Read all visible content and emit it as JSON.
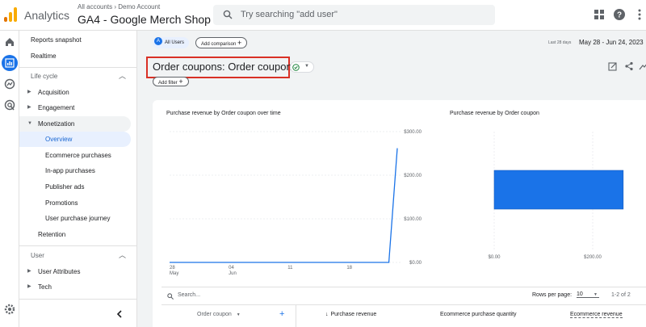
{
  "topbar": {
    "app_name": "Analytics",
    "breadcrumb": "All accounts › Demo Account",
    "property": "GA4 - Google Merch Shop",
    "search_placeholder": "Try searching \"add user\""
  },
  "sidebar": {
    "reports_snapshot": "Reports snapshot",
    "realtime": "Realtime",
    "lifecycle_label": "Life cycle",
    "acquisition": "Acquisition",
    "engagement": "Engagement",
    "monetization": "Monetization",
    "overview": "Overview",
    "ecommerce_purchases": "Ecommerce purchases",
    "in_app_purchases": "In-app purchases",
    "publisher_ads": "Publisher ads",
    "promotions": "Promotions",
    "user_purchase_journey": "User purchase journey",
    "retention": "Retention",
    "user_label": "User",
    "user_attributes": "User Attributes",
    "tech": "Tech"
  },
  "header": {
    "all_users": "All Users",
    "all_users_avatar": "A",
    "add_comparison": "Add comparison",
    "date_label": "Last 28 days",
    "date_range": "May 28 - Jun 24, 2023",
    "title": "Order coupons: Order coupon",
    "add_filter": "Add filter"
  },
  "colors": {
    "brand_blue": "#1a73e8",
    "bar_blue": "#1a73e8",
    "title_border": "#d93025",
    "check_green": "#188038"
  },
  "charts": {
    "line_title": "Purchase revenue by Order coupon over time",
    "bar_title": "Purchase revenue by Order coupon"
  },
  "chart_data": [
    {
      "type": "line",
      "title": "Purchase revenue by Order coupon over time",
      "x_ticks": [
        {
          "day": "28",
          "month": "May"
        },
        {
          "day": "04",
          "month": "Jun"
        },
        {
          "day": "11",
          "month": ""
        },
        {
          "day": "18",
          "month": ""
        }
      ],
      "y_ticks": [
        "$300.00",
        "$200.00",
        "$100.00",
        "$0.00"
      ],
      "ylim": [
        0,
        300
      ],
      "x": [
        "May 28",
        "May 29",
        "May 30",
        "May 31",
        "Jun 1",
        "Jun 2",
        "Jun 3",
        "Jun 4",
        "Jun 5",
        "Jun 6",
        "Jun 7",
        "Jun 8",
        "Jun 9",
        "Jun 10",
        "Jun 11",
        "Jun 12",
        "Jun 13",
        "Jun 14",
        "Jun 15",
        "Jun 16",
        "Jun 17",
        "Jun 18",
        "Jun 19",
        "Jun 20",
        "Jun 21",
        "Jun 22",
        "Jun 23",
        "Jun 24"
      ],
      "series": [
        {
          "values": [
            0,
            0,
            0,
            0,
            0,
            0,
            0,
            0,
            0,
            0,
            0,
            0,
            0,
            0,
            0,
            0,
            0,
            0,
            0,
            0,
            0,
            0,
            0,
            0,
            0,
            0,
            0,
            262
          ]
        }
      ]
    },
    {
      "type": "bar",
      "orientation": "horizontal",
      "title": "Purchase revenue by Order coupon",
      "x_ticks": [
        "$0.00",
        "$200.00"
      ],
      "xlim": [
        0,
        200
      ],
      "values": [
        262
      ]
    }
  ],
  "table": {
    "search_placeholder": "Search...",
    "rows_per_page_label": "Rows per page:",
    "rows_per_page": "10",
    "pagination": "1-2 of 2",
    "col_dimension": "Order coupon",
    "col_revenue": "Purchase revenue",
    "col_quantity": "Ecommerce purchase quantity",
    "col_ecom_revenue": "Ecommerce revenue"
  }
}
